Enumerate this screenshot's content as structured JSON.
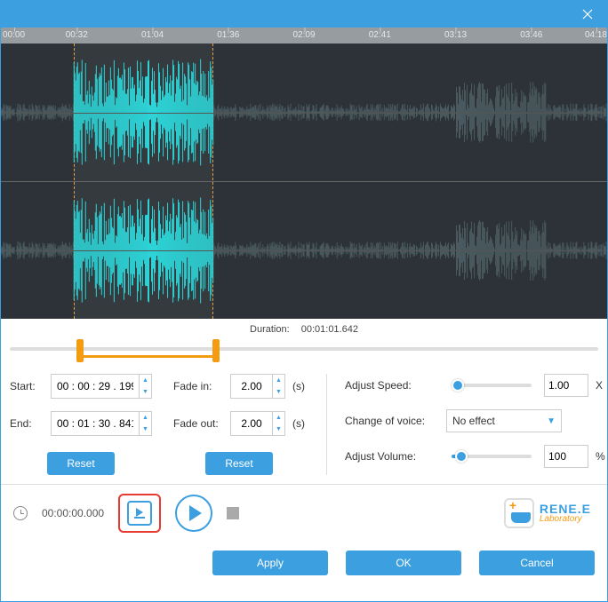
{
  "ruler": [
    "00:00",
    "00:32",
    "01:04",
    "01:36",
    "02:09",
    "02:41",
    "03:13",
    "03:46",
    "04:18"
  ],
  "selection": {
    "start_pct": 12,
    "end_pct": 35
  },
  "duration": {
    "label": "Duration:",
    "value": "00:01:01.642"
  },
  "left": {
    "start_label": "Start:",
    "start_value": "00 : 00 : 29 . 199",
    "end_label": "End:",
    "end_value": "00 : 01 : 30 . 841",
    "reset": "Reset"
  },
  "mid": {
    "fadein_label": "Fade in:",
    "fadein_value": "2.00",
    "fadeout_label": "Fade out:",
    "fadeout_value": "2.00",
    "unit": "(s)",
    "reset": "Reset"
  },
  "right": {
    "speed_label": "Adjust Speed:",
    "speed_value": "1.00",
    "speed_unit": "X",
    "speed_pct": 8,
    "voice_label": "Change of voice:",
    "voice_value": "No effect",
    "volume_label": "Adjust Volume:",
    "volume_value": "100",
    "volume_unit": "%",
    "volume_pct": 12
  },
  "playback": {
    "time": "00:00:00.000"
  },
  "logo": {
    "line1": "RENE.E",
    "line2": "Laboratory"
  },
  "footer": {
    "apply": "Apply",
    "ok": "OK",
    "cancel": "Cancel"
  }
}
